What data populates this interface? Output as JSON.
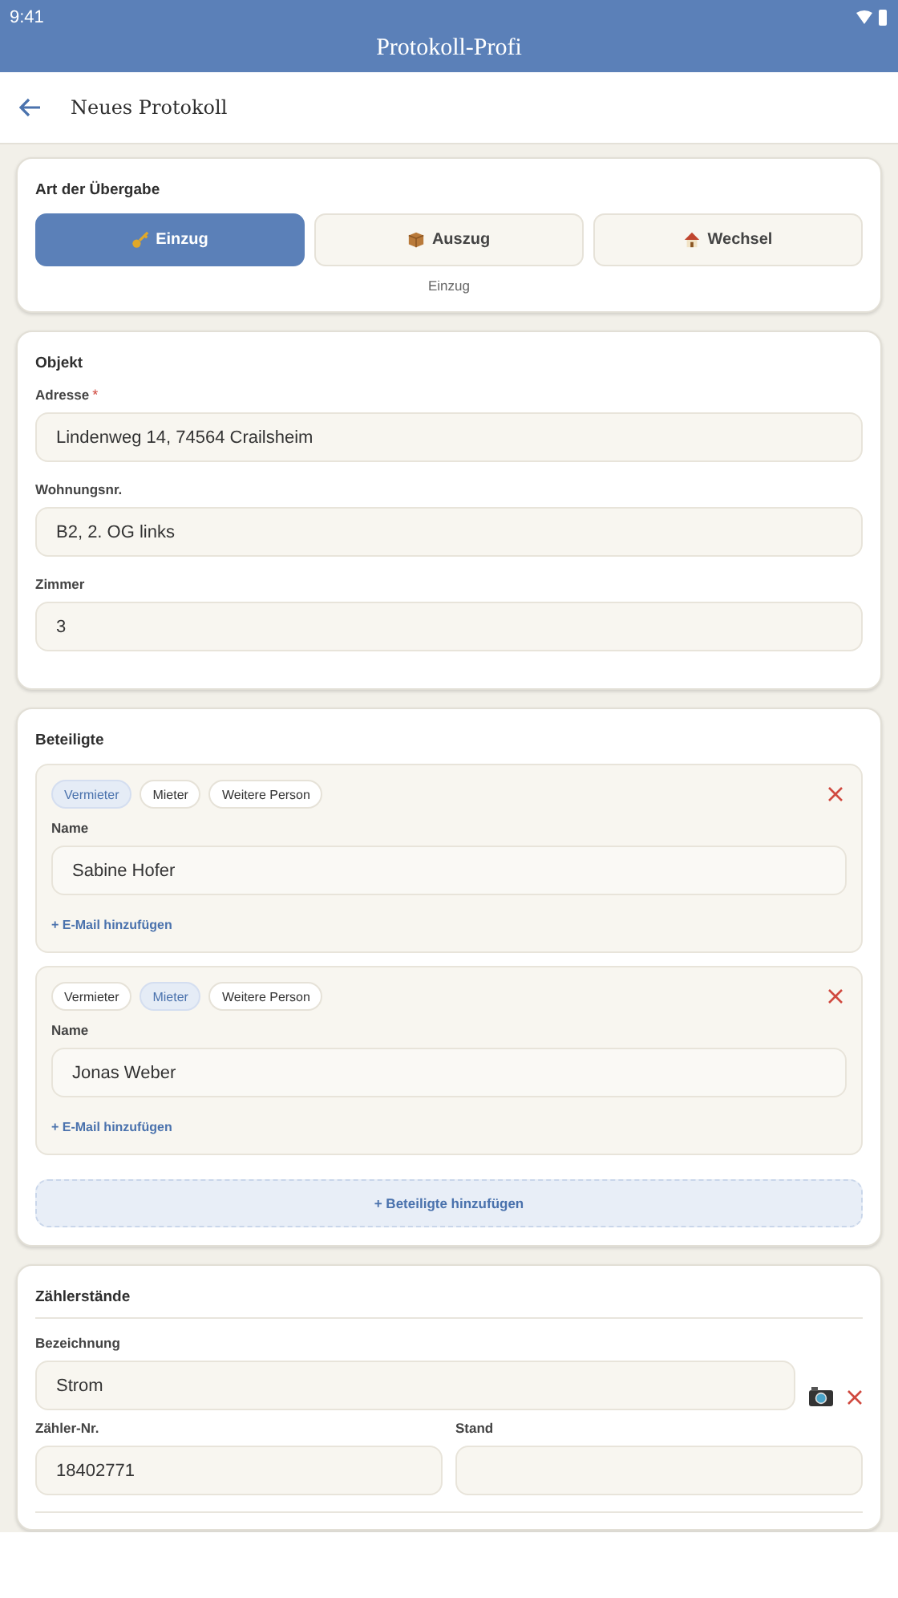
{
  "status_bar": {
    "time": "9:41"
  },
  "app_bar": {
    "title": "Protokoll-Profi"
  },
  "header": {
    "title": "Neues Protokoll"
  },
  "handover": {
    "title": "Art der Übergabe",
    "options": [
      {
        "label": "Einzug",
        "kind": "key",
        "selected": true
      },
      {
        "label": "Auszug",
        "kind": "box",
        "selected": false
      },
      {
        "label": "Wechsel",
        "kind": "house",
        "selected": false
      }
    ],
    "caption": "Einzug"
  },
  "object": {
    "title": "Objekt",
    "fields": [
      {
        "label": "Adresse",
        "required_mark": "*",
        "value": "Lindenweg 14, 74564 Crailsheim"
      },
      {
        "label": "Wohnungsnr.",
        "value": "B2, 2. OG links"
      },
      {
        "label": "Zimmer",
        "value": "3"
      }
    ]
  },
  "participants": {
    "title": "Beteiligte",
    "people": [
      {
        "roles": [
          {
            "label": "Vermieter",
            "selected": true
          },
          {
            "label": "Mieter",
            "selected": false
          },
          {
            "label": "Weitere Person",
            "selected": false
          }
        ],
        "name_label": "Name",
        "name": "Sabine Hofer",
        "add_email": "+ E-Mail hinzufügen"
      },
      {
        "roles": [
          {
            "label": "Vermieter",
            "selected": false
          },
          {
            "label": "Mieter",
            "selected": true
          },
          {
            "label": "Weitere Person",
            "selected": false
          }
        ],
        "name_label": "Name",
        "name": "Jonas Weber",
        "add_email": "+ E-Mail hinzufügen"
      }
    ],
    "add_button": "+ Beteiligte hinzufügen"
  },
  "meters": {
    "title": "Zählerstände",
    "items": [
      {
        "label_label": "Bezeichnung",
        "label": "Strom",
        "number_label": "Zähler-Nr.",
        "number": "18402771",
        "reading_label": "Stand"
      }
    ]
  }
}
